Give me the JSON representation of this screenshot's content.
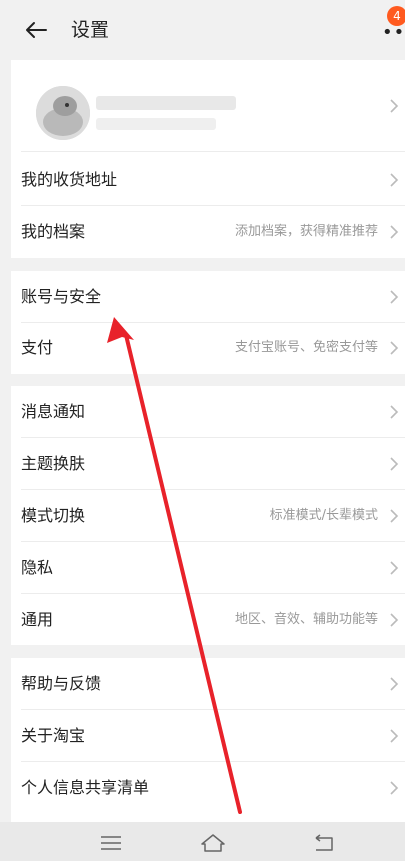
{
  "header": {
    "title": "设置",
    "badge_count": "4"
  },
  "sections": [
    {
      "items": [
        {
          "label": "我的收货地址",
          "hint": ""
        },
        {
          "label": "我的档案",
          "hint": "添加档案，获得精准推荐"
        }
      ]
    },
    {
      "items": [
        {
          "label": "账号与安全",
          "hint": ""
        },
        {
          "label": "支付",
          "hint": "支付宝账号、免密支付等"
        }
      ]
    },
    {
      "items": [
        {
          "label": "消息通知",
          "hint": ""
        },
        {
          "label": "主题换肤",
          "hint": ""
        },
        {
          "label": "模式切换",
          "hint": "标准模式/长辈模式"
        },
        {
          "label": "隐私",
          "hint": ""
        },
        {
          "label": "通用",
          "hint": "地区、音效、辅助功能等"
        }
      ]
    },
    {
      "items": [
        {
          "label": "帮助与反馈",
          "hint": ""
        },
        {
          "label": "关于淘宝",
          "hint": ""
        },
        {
          "label": "个人信息共享清单",
          "hint": ""
        }
      ]
    }
  ],
  "colors": {
    "accent": "#ff5a1f",
    "arrow": "#e8222a",
    "background": "#f1f1f1"
  },
  "icons": {
    "back": "back-arrow-icon",
    "more": "more-dots-icon",
    "chevron": "chevron-right-icon",
    "nav_menu": "menu-icon",
    "nav_home": "home-icon",
    "nav_back": "back-icon"
  }
}
